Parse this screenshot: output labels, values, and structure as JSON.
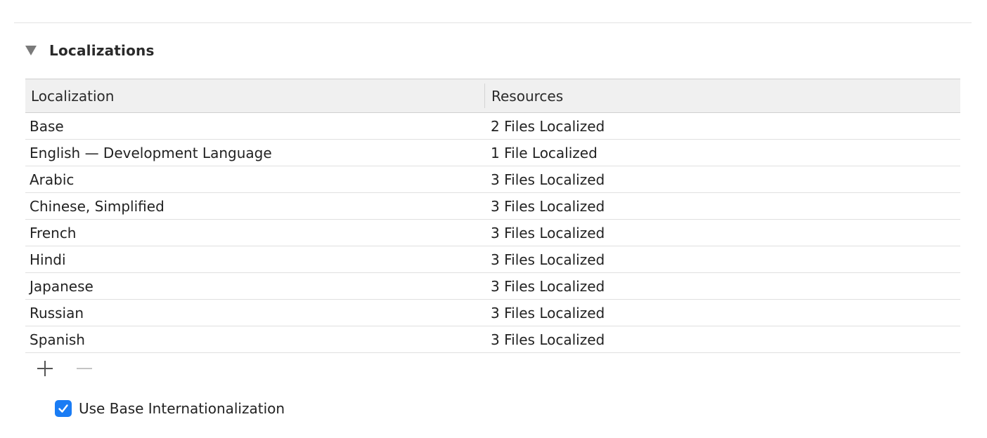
{
  "section": {
    "title": "Localizations",
    "expanded": true
  },
  "table": {
    "columns": [
      "Localization",
      "Resources"
    ],
    "rows": [
      {
        "localization": "Base",
        "resources": "2 Files Localized"
      },
      {
        "localization": "English — Development Language",
        "resources": "1 File Localized"
      },
      {
        "localization": "Arabic",
        "resources": "3 Files Localized"
      },
      {
        "localization": "Chinese, Simplified",
        "resources": "3 Files Localized"
      },
      {
        "localization": "French",
        "resources": "3 Files Localized"
      },
      {
        "localization": "Hindi",
        "resources": "3 Files Localized"
      },
      {
        "localization": "Japanese",
        "resources": "3 Files Localized"
      },
      {
        "localization": "Russian",
        "resources": "3 Files Localized"
      },
      {
        "localization": "Spanish",
        "resources": "3 Files Localized"
      }
    ]
  },
  "controls": {
    "add_icon": "plus-icon",
    "remove_icon": "minus-icon",
    "remove_enabled": false
  },
  "option": {
    "label": "Use Base Internationalization",
    "checked": true
  },
  "colors": {
    "accent": "#1a7cf4",
    "header_bg": "#f0f0f0",
    "separator": "#e0e0e0"
  }
}
